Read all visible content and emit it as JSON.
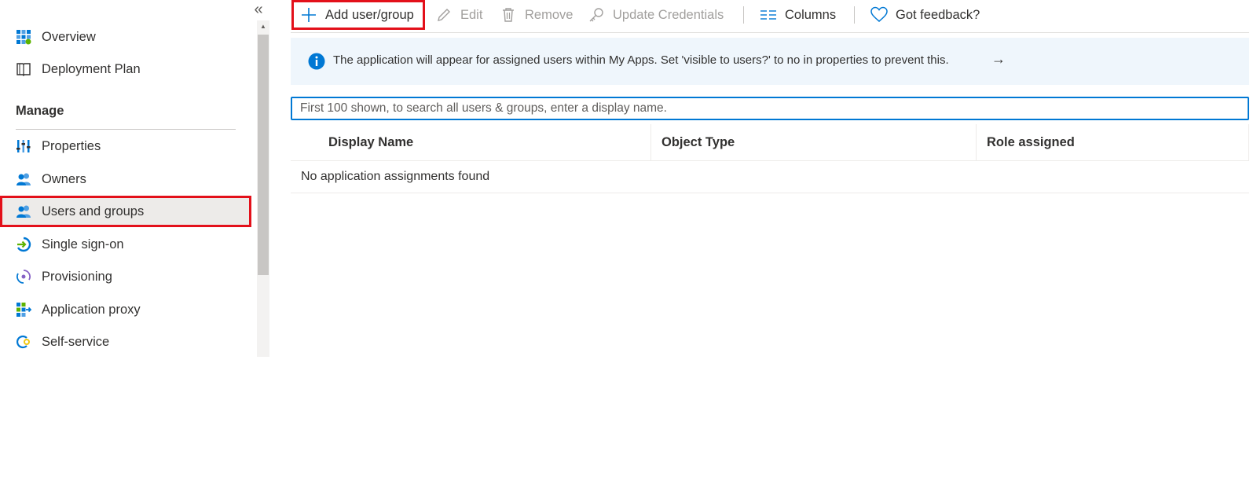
{
  "sidebar": {
    "collapse_glyph": "«",
    "items": [
      {
        "label": "Overview",
        "icon": "grid-icon"
      },
      {
        "label": "Deployment Plan",
        "icon": "book-icon"
      }
    ],
    "section_title": "Manage",
    "manage_items": [
      {
        "label": "Properties",
        "icon": "properties-icon"
      },
      {
        "label": "Owners",
        "icon": "owners-icon"
      },
      {
        "label": "Users and groups",
        "icon": "users-icon",
        "active": true
      },
      {
        "label": "Single sign-on",
        "icon": "sso-icon"
      },
      {
        "label": "Provisioning",
        "icon": "provisioning-icon"
      },
      {
        "label": "Application proxy",
        "icon": "app-proxy-icon"
      },
      {
        "label": "Self-service",
        "icon": "self-service-icon"
      }
    ]
  },
  "toolbar": {
    "add_label": "Add user/group",
    "edit_label": "Edit",
    "remove_label": "Remove",
    "update_credentials_label": "Update Credentials",
    "columns_label": "Columns",
    "feedback_label": "Got feedback?"
  },
  "banner": {
    "message": "The application will appear for assigned users within My Apps. Set 'visible to users?' to no in properties to prevent this.",
    "arrow": "→"
  },
  "search": {
    "placeholder": "First 100 shown, to search all users & groups, enter a display name.",
    "value": ""
  },
  "table": {
    "columns": [
      "Display Name",
      "Object Type",
      "Role assigned"
    ],
    "empty_message": "No application assignments found"
  },
  "colors": {
    "accent": "#0078d4",
    "highlight": "#e3101a",
    "banner_bg": "#eff6fc"
  }
}
